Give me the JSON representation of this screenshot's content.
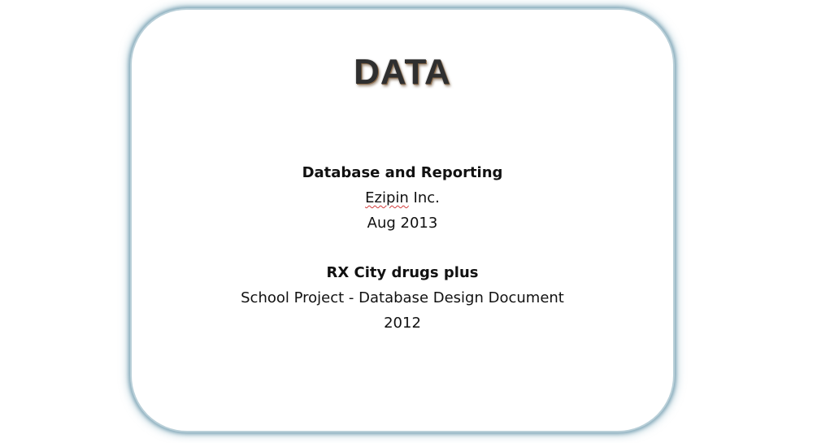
{
  "title": "DATA",
  "section1": {
    "heading": "Database and Reporting",
    "company_name": "Ezipin",
    "company_suffix": " Inc.",
    "date": "Aug 2013"
  },
  "section2": {
    "heading": "RX City drugs plus",
    "description": "School Project - Database Design Document",
    "year": "2012"
  },
  "colors": {
    "frame": "#8fb3c2",
    "title_text": "#2f2f2f",
    "spellcheck_underline": "#d23b3b"
  }
}
